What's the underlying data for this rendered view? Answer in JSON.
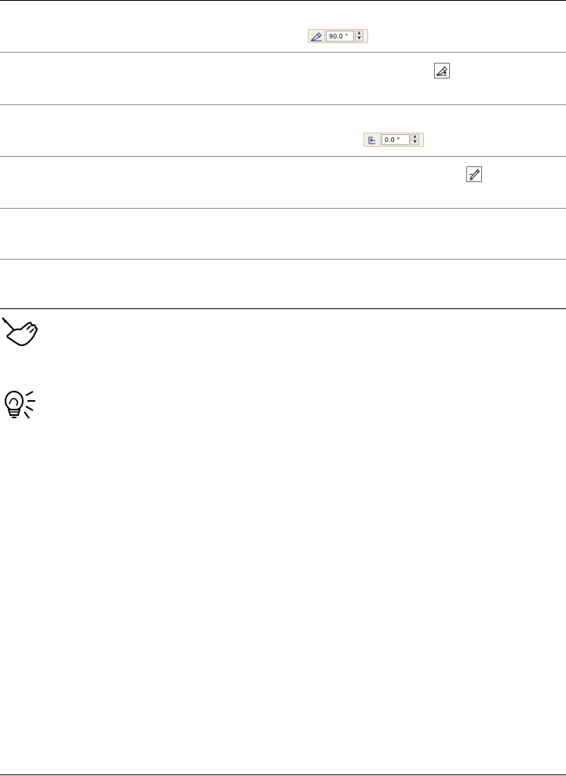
{
  "rows": [
    {
      "id": "row-1",
      "control": {
        "type": "spin",
        "icon": "pen-angle-icon",
        "value": "90.0 °"
      }
    },
    {
      "id": "row-2",
      "control": {
        "type": "button",
        "icon": "calligraphic-pen-icon"
      }
    },
    {
      "id": "row-3",
      "control": {
        "type": "spin",
        "icon": "rotation-angle-icon",
        "value": "0.0 °"
      }
    },
    {
      "id": "row-4",
      "control": {
        "type": "button",
        "icon": "pen-edit-icon"
      }
    },
    {
      "id": "row-5",
      "control": null
    },
    {
      "id": "row-6",
      "control": null
    }
  ],
  "margin_icons": [
    {
      "name": "note-hand-icon"
    },
    {
      "name": "tip-lightbulb-icon"
    }
  ],
  "controls": {
    "spin_up": "▲",
    "spin_down": "▼"
  }
}
